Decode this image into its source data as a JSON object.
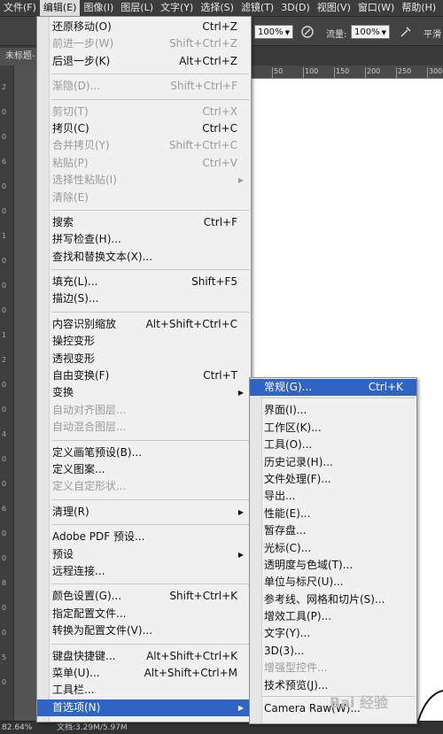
{
  "menubar": [
    {
      "label": "文件(F)"
    },
    {
      "label": "编辑(E)",
      "active": true
    },
    {
      "label": "图像(I)"
    },
    {
      "label": "图层(L)"
    },
    {
      "label": "文字(Y)"
    },
    {
      "label": "选择(S)"
    },
    {
      "label": "滤镜(T)"
    },
    {
      "label": "3D(D)"
    },
    {
      "label": "视图(V)"
    },
    {
      "label": "窗口(W)"
    },
    {
      "label": "帮助(H)"
    }
  ],
  "options": {
    "opacity_value": "100%",
    "flow_label": "流量:",
    "flow_value": "100%",
    "smooth_label": "平滑"
  },
  "doc_tab": "未标题-",
  "toolstrip_digits": [
    "2",
    "0",
    "0",
    "6",
    "0",
    "0",
    "1",
    "0",
    "0",
    "0",
    "1",
    "2",
    "0",
    "0",
    "4",
    "0",
    "0",
    "6",
    "0",
    "0",
    "8",
    "0",
    "0",
    "5",
    "0"
  ],
  "ruler_numbers": [
    "50",
    "100",
    "150",
    "200",
    "250",
    "300"
  ],
  "status": {
    "zoom": "82.64%",
    "doc": "文档:3.29M/5.97M"
  },
  "edit_menu": [
    {
      "label": "还原移动(O)",
      "shortcut": "Ctrl+Z"
    },
    {
      "label": "前进一步(W)",
      "shortcut": "Shift+Ctrl+Z",
      "disabled": true
    },
    {
      "label": "后退一步(K)",
      "shortcut": "Alt+Ctrl+Z"
    },
    {
      "sep": true
    },
    {
      "label": "渐隐(D)...",
      "shortcut": "Shift+Ctrl+F",
      "disabled": true
    },
    {
      "sep": true
    },
    {
      "label": "剪切(T)",
      "shortcut": "Ctrl+X",
      "disabled": true
    },
    {
      "label": "拷贝(C)",
      "shortcut": "Ctrl+C"
    },
    {
      "label": "合并拷贝(Y)",
      "shortcut": "Shift+Ctrl+C",
      "disabled": true
    },
    {
      "label": "粘贴(P)",
      "shortcut": "Ctrl+V",
      "disabled": true
    },
    {
      "label": "选择性粘贴(I)",
      "submenu": true,
      "disabled": true
    },
    {
      "label": "清除(E)",
      "disabled": true
    },
    {
      "sep": true
    },
    {
      "label": "搜索",
      "shortcut": "Ctrl+F"
    },
    {
      "label": "拼写检查(H)..."
    },
    {
      "label": "查找和替换文本(X)..."
    },
    {
      "sep": true
    },
    {
      "label": "填充(L)...",
      "shortcut": "Shift+F5"
    },
    {
      "label": "描边(S)..."
    },
    {
      "sep": true
    },
    {
      "label": "内容识别缩放",
      "shortcut": "Alt+Shift+Ctrl+C"
    },
    {
      "label": "操控变形"
    },
    {
      "label": "透视变形"
    },
    {
      "label": "自由变换(F)",
      "shortcut": "Ctrl+T"
    },
    {
      "label": "变换",
      "submenu": true
    },
    {
      "label": "自动对齐图层...",
      "disabled": true
    },
    {
      "label": "自动混合图层...",
      "disabled": true
    },
    {
      "sep": true
    },
    {
      "label": "定义画笔预设(B)..."
    },
    {
      "label": "定义图案..."
    },
    {
      "label": "定义自定形状...",
      "disabled": true
    },
    {
      "sep": true
    },
    {
      "label": "清理(R)",
      "submenu": true
    },
    {
      "sep": true
    },
    {
      "label": "Adobe PDF 预设..."
    },
    {
      "label": "预设",
      "submenu": true
    },
    {
      "label": "远程连接..."
    },
    {
      "sep": true
    },
    {
      "label": "颜色设置(G)...",
      "shortcut": "Shift+Ctrl+K"
    },
    {
      "label": "指定配置文件..."
    },
    {
      "label": "转换为配置文件(V)..."
    },
    {
      "sep": true
    },
    {
      "label": "键盘快捷键...",
      "shortcut": "Alt+Shift+Ctrl+K"
    },
    {
      "label": "菜单(U)...",
      "shortcut": "Alt+Shift+Ctrl+M"
    },
    {
      "label": "工具栏..."
    },
    {
      "label": "首选项(N)",
      "submenu": true,
      "highlighted": true
    }
  ],
  "prefs_menu": [
    {
      "label": "常规(G)...",
      "shortcut": "Ctrl+K",
      "highlighted": true
    },
    {
      "sep": true
    },
    {
      "label": "界面(I)..."
    },
    {
      "label": "工作区(K)..."
    },
    {
      "label": "工具(O)..."
    },
    {
      "label": "历史记录(H)..."
    },
    {
      "label": "文件处理(F)..."
    },
    {
      "label": "导出..."
    },
    {
      "label": "性能(E)..."
    },
    {
      "label": "暂存盘..."
    },
    {
      "label": "光标(C)..."
    },
    {
      "label": "透明度与色域(T)..."
    },
    {
      "label": "单位与标尺(U)..."
    },
    {
      "label": "参考线、网格和切片(S)..."
    },
    {
      "label": "增效工具(P)..."
    },
    {
      "label": "文字(Y)..."
    },
    {
      "label": "3D(3)..."
    },
    {
      "label": "增强型控件...",
      "disabled": true
    },
    {
      "label": "技术预览(J)..."
    },
    {
      "sep": true
    },
    {
      "label": "Camera Raw(W)..."
    }
  ],
  "colors": {
    "highlight": "#2f63c4",
    "menu_bg": "#f0f0f0",
    "chrome": "#3c3c3c"
  }
}
